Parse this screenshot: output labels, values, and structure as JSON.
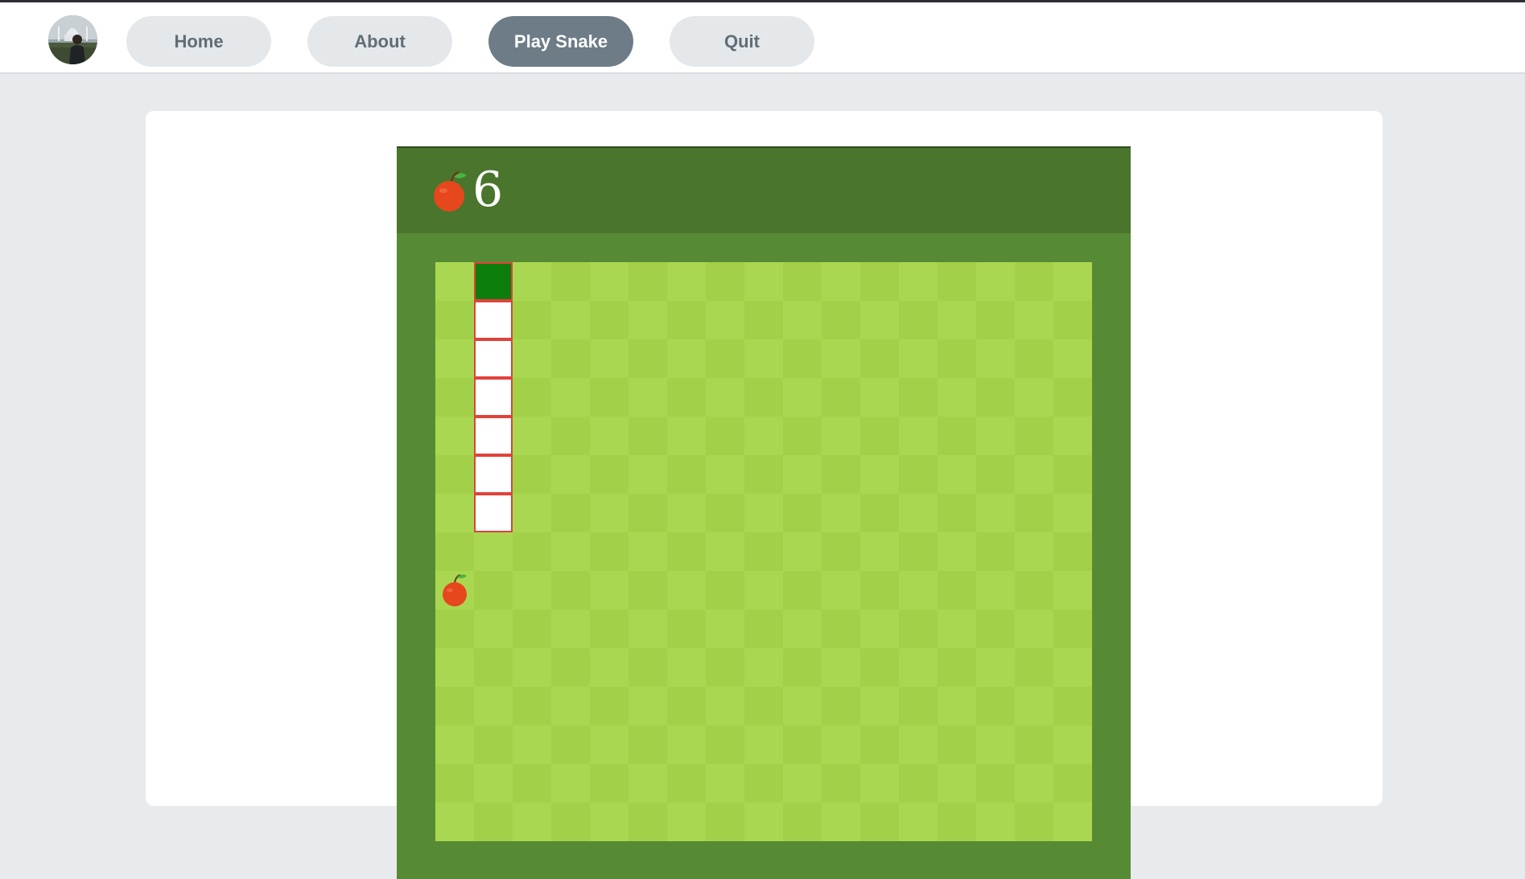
{
  "nav": {
    "items": [
      {
        "label": "Home",
        "active": false
      },
      {
        "label": "About",
        "active": false
      },
      {
        "label": "Play Snake",
        "active": true
      },
      {
        "label": "Quit",
        "active": false
      }
    ]
  },
  "game": {
    "score": "6",
    "grid": {
      "columns": 17,
      "rows": 15
    },
    "snake": {
      "head": {
        "col": 1,
        "row": 0
      },
      "body": [
        {
          "col": 1,
          "row": 1
        },
        {
          "col": 1,
          "row": 2
        },
        {
          "col": 1,
          "row": 3
        },
        {
          "col": 1,
          "row": 4
        },
        {
          "col": 1,
          "row": 5
        },
        {
          "col": 1,
          "row": 6
        }
      ]
    },
    "food": {
      "col": 0,
      "row": 8
    },
    "colors": {
      "header": "#4a752c",
      "border": "#578a34",
      "cell_light": "#aad751",
      "cell_dark": "#a2d149",
      "snake_head": "#0b7e0b",
      "snake_body": "#ffffff",
      "snake_outline": "#e0423a",
      "apple": "#e7471d"
    },
    "icons": {
      "score": "apple-icon",
      "food": "apple-icon"
    }
  }
}
